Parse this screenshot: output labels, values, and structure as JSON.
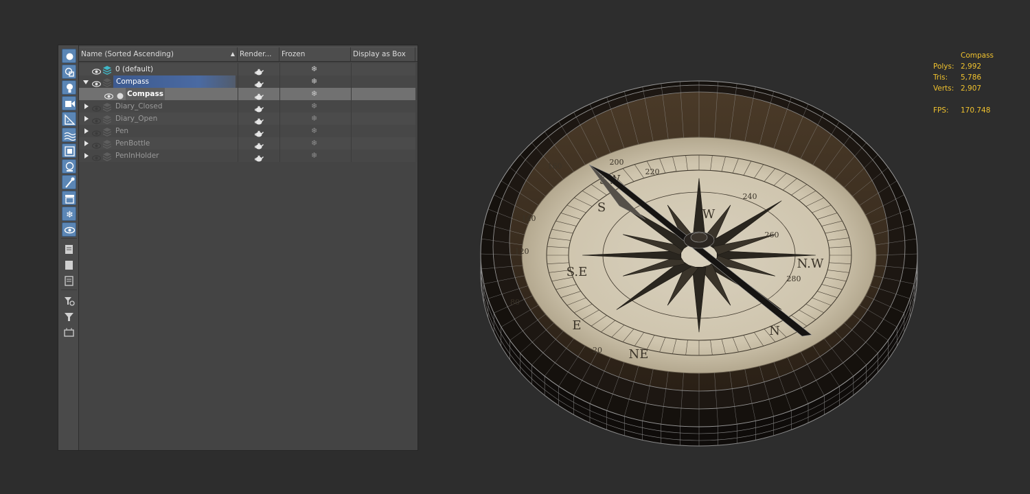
{
  "scene_explorer": {
    "columns": [
      {
        "label": "Name (Sorted Ascending)",
        "sort_indicator": "▲"
      },
      {
        "label": "Render..."
      },
      {
        "label": "Frozen"
      },
      {
        "label": "Display as Box"
      }
    ],
    "rows": [
      {
        "name": "0 (default)",
        "kind": "layer-default",
        "depth": 0,
        "expander": "none",
        "visible": true,
        "state": "normal"
      },
      {
        "name": "Compass",
        "kind": "layer",
        "depth": 0,
        "expander": "expanded",
        "visible": true,
        "state": "highlighted"
      },
      {
        "name": "Compass",
        "kind": "object",
        "depth": 1,
        "expander": "none",
        "visible": true,
        "state": "selected"
      },
      {
        "name": "Diary_Closed",
        "kind": "layer",
        "depth": 0,
        "expander": "collapsed",
        "visible": false,
        "state": "hidden"
      },
      {
        "name": "Diary_Open",
        "kind": "layer",
        "depth": 0,
        "expander": "collapsed",
        "visible": false,
        "state": "hidden"
      },
      {
        "name": "Pen",
        "kind": "layer",
        "depth": 0,
        "expander": "collapsed",
        "visible": false,
        "state": "hidden"
      },
      {
        "name": "PenBottle",
        "kind": "layer",
        "depth": 0,
        "expander": "collapsed",
        "visible": false,
        "state": "hidden"
      },
      {
        "name": "PenInHolder",
        "kind": "layer",
        "depth": 0,
        "expander": "collapsed",
        "visible": false,
        "state": "hidden"
      }
    ],
    "toolbar_icons": [
      "display-geometry-icon",
      "display-shapes-icon",
      "display-lights-icon",
      "display-cameras-icon",
      "display-helpers-icon",
      "display-spacewarps-icon",
      "display-groups-icon",
      "display-xrefs-icon",
      "display-bones-icon",
      "display-containers-icon",
      "display-frozen-icon",
      "display-hidden-icon",
      "display-all-icon",
      "display-none-icon",
      "invert-display-icon",
      "filter-settings-icon",
      "filter-icon",
      "select-children-icon"
    ]
  },
  "viewport": {
    "object_name": "Compass",
    "stats": [
      {
        "label": "Polys:",
        "value": "2,992"
      },
      {
        "label": "Tris:",
        "value": "5,786"
      },
      {
        "label": "Verts:",
        "value": "2,907"
      }
    ],
    "fps_label": "FPS:",
    "fps_value": "170.748",
    "dial_labels": [
      "SW",
      "W",
      "N.W",
      "N",
      "NE",
      "E",
      "S.E",
      "S",
      "120",
      "140",
      "160",
      "200",
      "220",
      "240",
      "260",
      "280",
      "20",
      "80"
    ]
  },
  "colors": {
    "stats_text": "#f0c22e",
    "toolbar_active": "#5b86b5",
    "highlight": "#3d5a8f"
  }
}
